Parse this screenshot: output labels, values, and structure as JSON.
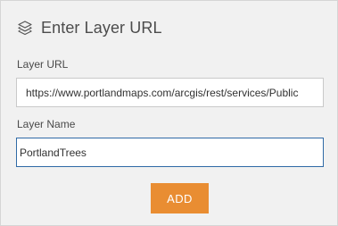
{
  "header": {
    "icon": "layers-icon",
    "title": "Enter Layer URL"
  },
  "form": {
    "url_label": "Layer URL",
    "url_value": "https://www.portlandmaps.com/arcgis/rest/services/Public",
    "name_label": "Layer Name",
    "name_value": "PortlandTrees"
  },
  "actions": {
    "add_label": "ADD"
  },
  "colors": {
    "panel_background": "#f1f1f1",
    "button_accent": "#e98d32",
    "focus_border": "#2f6aa6"
  }
}
